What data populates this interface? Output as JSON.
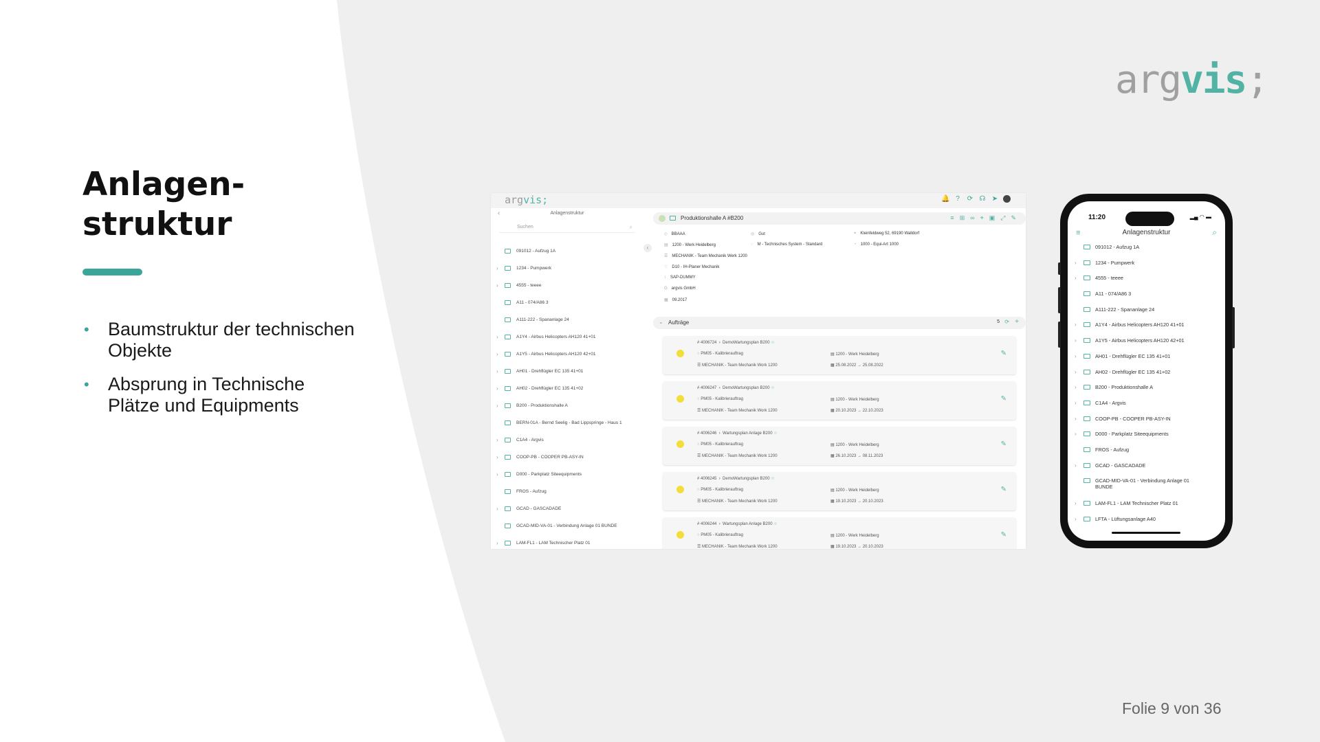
{
  "slide": {
    "title_line1": "Anlagen-",
    "title_line2": "struktur",
    "bullets": [
      "Baumstruktur der technischen Objekte",
      "Absprung in Technische Plätze und Equipments"
    ],
    "logo_part1": "arg",
    "logo_part2": "vis",
    "logo_part3": ";",
    "slide_number": "Folie 9 von 36",
    "colors": {
      "accent": "#3aa69a",
      "logo_gray": "#a0a0a0",
      "logo_teal": "#52b3a4"
    }
  },
  "desktop": {
    "logo_part1": "arg",
    "logo_part2": "vis;",
    "tree": {
      "heading": "Anlagenstruktur",
      "search_placeholder": "Suchen",
      "items": [
        "091012 - Aufzug 1A",
        "1234 - Pumpwerk",
        "4555 - teeee",
        "A11 - 074/A86 3",
        "A111-222 - Spananlage 24",
        "A1Y4 - Airbus Helicopters AH120 41+01",
        "A1Y5 - Airbus Helicopters AH120 42+01",
        "AH01 - Drehflügler EC 135 41+01",
        "AH02 - Drehflügler EC 135 41+02",
        "B200 - Produktionshalle A",
        "BERN-01A - Bernd Seelig - Bad Lippspringe - Haus 1",
        "C1A4 - Argvis",
        "COOP-PB - COOPER PB-ASY-IN",
        "D000 - Parkplatz Siteequipments",
        "FROS - Aufzug",
        "GCAD - GASCADADE",
        "GCAD-MID-VA-01 - Verbindung Anlage 01 BUNDE",
        "LAM-FL1 - LAM Technischer Platz 01"
      ]
    },
    "detail": {
      "title": "Produktionshalle A #B200",
      "props": {
        "p1": "BBAAA",
        "p2": "1200 - Werk Heidelberg",
        "p3": "MECHANIK - Team Mechanik Werk 1200",
        "p4": "D10 - IH-Planer Mechanik",
        "p5": "SAP-DUMMY",
        "p6": "argvis GmbH",
        "p7": "09.2017",
        "p8": "Gut",
        "p9": "M - Technisches System - Standard",
        "p10": "Kleinfeldweg 52, 69190 Walldorf",
        "p11": "1000 - Equi-Art 1000"
      },
      "orders_title": "Aufträge",
      "orders_count": "5",
      "orders": [
        {
          "number": "4006724",
          "title": "DemoWartungsplan B200",
          "type": "PM05 - Kalibrierauftrag",
          "plant": "1200 - Werk Heidelberg",
          "team": "MECHANIK - Team Mechanik Work 1200",
          "dates": "25.08.2022 → 25.08.2022"
        },
        {
          "number": "4006247",
          "title": "DemoWartungsplan B200",
          "type": "PM05 - Kalibrierauftrag",
          "plant": "1200 - Werk Heidelberg",
          "team": "MECHANIK - Team Mechanik Work 1200",
          "dates": "20.10.2023 → 22.10.2023"
        },
        {
          "number": "4006246",
          "title": "Wartungsplan Anlage B200",
          "type": "PM05 - Kalibrierauftrag",
          "plant": "1200 - Werk Heidelberg",
          "team": "MECHANIK - Team Mechanik Work 1200",
          "dates": "26.10.2023 → 08.11.2023"
        },
        {
          "number": "4006245",
          "title": "DemoWartungsplan B200",
          "type": "PM05 - Kalibrierauftrag",
          "plant": "1200 - Werk Heidelberg",
          "team": "MECHANIK - Team Mechanik Work 1200",
          "dates": "19.10.2023 → 20.10.2023"
        },
        {
          "number": "4006244",
          "title": "Wartungsplan Anlage B200",
          "type": "PM05 - Kalibrierauftrag",
          "plant": "1200 - Werk Heidelberg",
          "team": "MECHANIK - Team Mechanik Work 1200",
          "dates": "19.10.2023 → 20.10.2023"
        }
      ]
    }
  },
  "phone": {
    "time": "11:20",
    "heading": "Anlagenstruktur",
    "items": [
      "091012 - Aufzug 1A",
      "1234 - Pumpwerk",
      "4555 - teeee",
      "A11 - 074/A86 3",
      "A111-222 - Spananlage 24",
      "A1Y4 - Airbus Helicopters AH120 41+01",
      "A1Y5 - Airbus Helicopters AH120 42+01",
      "AH01 - Drehflügler EC 135 41+01",
      "AH02 - Drehflügler EC 135 41+02",
      "B200 - Produktionshalle A",
      "C1A4 - Argvis",
      "COOP-PB - COOPER PB-ASY-IN",
      "D000 - Parkplatz Siteequipments",
      "FROS - Aufzug",
      "GCAD - GASCADADE",
      "GCAD-MID-VA-01 - Verbindung Anlage 01 BUNDE",
      "LAM-FL1 - LAM Technischer Platz 01",
      "LFTA - Lüftungsanlage A40"
    ]
  }
}
